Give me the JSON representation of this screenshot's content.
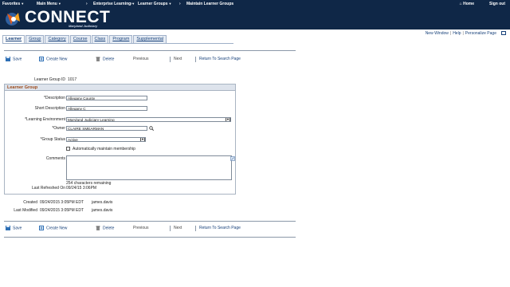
{
  "topnav": {
    "favorites": "Favorites",
    "main_menu": "Main Menu",
    "enterprise_learning": "Enterprise Learning",
    "learner_groups": "Learner Groups",
    "maintain": "Maintain Learner Groups",
    "home": "Home",
    "sign_out": "Sign out"
  },
  "brand": {
    "name": "CONNECT",
    "sub": "Maryland Judiciary"
  },
  "utilnav": {
    "new_window": "New Window",
    "help": "Help",
    "personalize": "Personalize Page"
  },
  "tabs": [
    "Learner",
    "Group",
    "Category",
    "Course",
    "Class",
    "Program",
    "Supplemental"
  ],
  "toolbar": {
    "save": "Save",
    "create_new": "Create New",
    "delete": "Delete",
    "previous": "Previous",
    "next": "Next",
    "return": "Return To Search Page"
  },
  "group_id_label": "Learner Group ID",
  "group_id": "1017",
  "section_title": "Learner Group",
  "form": {
    "description_label": "*Description",
    "description": "Allegany County",
    "short_desc_label": "Short Description",
    "short_desc": "Allegany C",
    "env_label": "*Learning Environment",
    "env": "Maryland Judiciary Learning",
    "owner_label": "*Owner",
    "owner": "CLAIRE SMEARMAN",
    "status_label": "*Group Status",
    "status": "Active",
    "auto_maintain": "Automatically maintain membership",
    "comments_label": "Comments",
    "chars_remaining": "254 characters remaining",
    "last_refreshed_label": "Last Refreshed On",
    "last_refreshed": "09/24/15  3:06PM"
  },
  "audit": {
    "created_label": "Created",
    "created_date": "09/24/2015  3:05PM EDT",
    "created_by": "james.davis",
    "modified_label": "Last Modified",
    "modified_date": "09/24/2015  3:05PM EDT",
    "modified_by": "james.davis"
  },
  "colors": {
    "header_bg": "#0f2747",
    "link": "#16407a",
    "section_title": "#9c4a1a"
  }
}
